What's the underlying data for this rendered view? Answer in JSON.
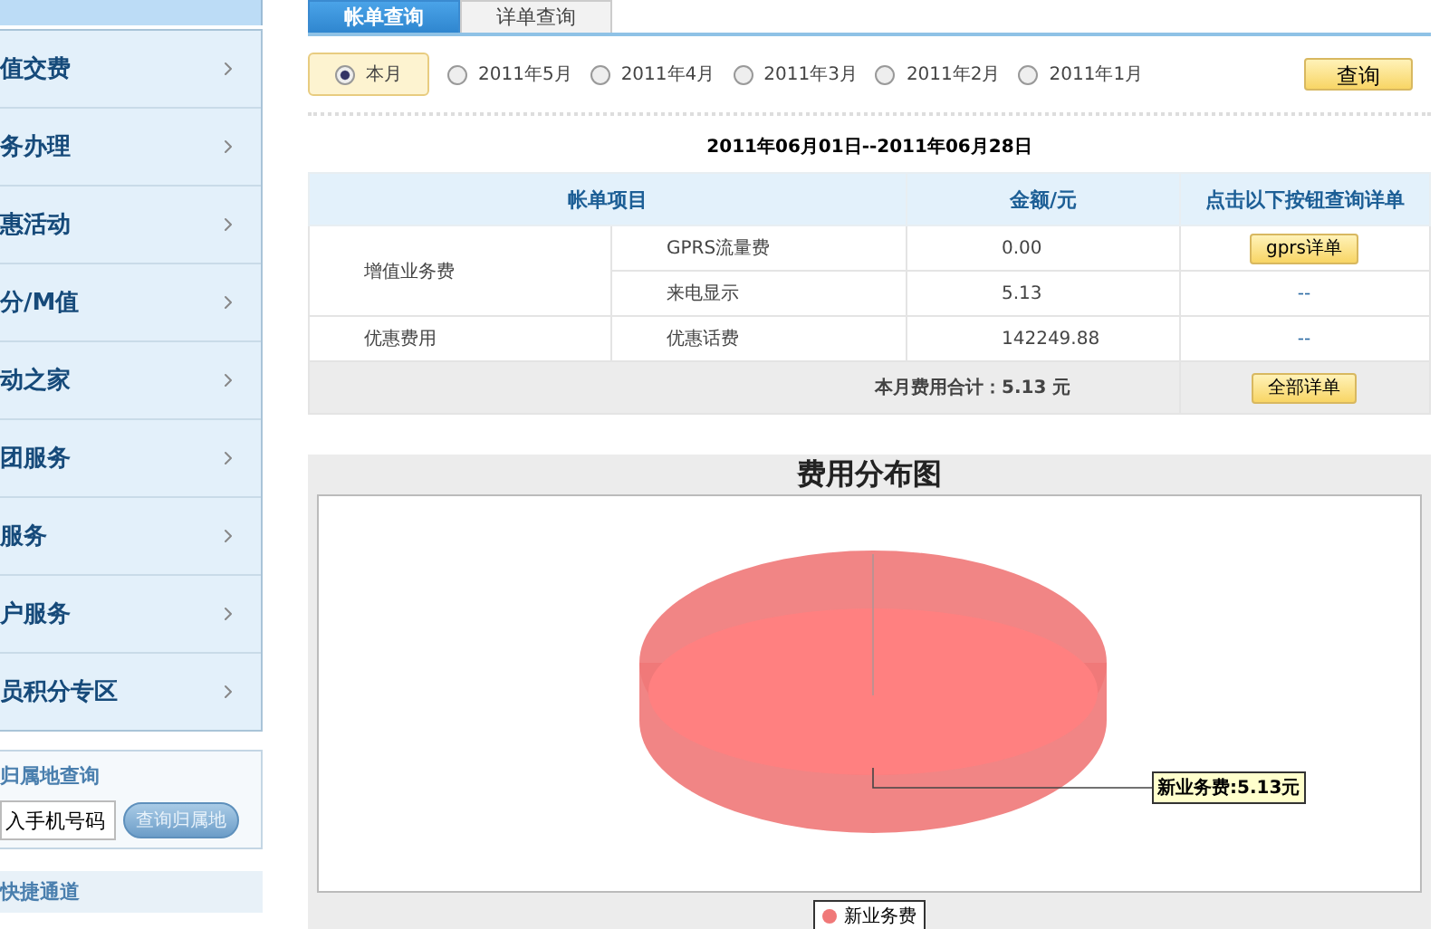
{
  "sidebar": {
    "items": [
      {
        "label": "值交费"
      },
      {
        "label": "务办理"
      },
      {
        "label": "惠活动"
      },
      {
        "label": "分/M值"
      },
      {
        "label": "动之家"
      },
      {
        "label": "团服务"
      },
      {
        "label": "服务"
      },
      {
        "label": "户服务"
      },
      {
        "label": "员积分专区"
      }
    ],
    "lookup": {
      "title": "归属地查询",
      "value": "入手机号码",
      "button": "查询归属地"
    },
    "shortcut": {
      "title": "快捷通道"
    }
  },
  "tabs": [
    {
      "label": "帐单查询",
      "selected": true
    },
    {
      "label": "详单查询",
      "selected": false
    }
  ],
  "months": [
    {
      "label": "本月",
      "selected": true
    },
    {
      "label": "2011年5月",
      "selected": false
    },
    {
      "label": "2011年4月",
      "selected": false
    },
    {
      "label": "2011年3月",
      "selected": false
    },
    {
      "label": "2011年2月",
      "selected": false
    },
    {
      "label": "2011年1月",
      "selected": false
    }
  ],
  "query_button": "查询",
  "date_range": "2011年06月01日--2011年06月28日",
  "table": {
    "columns": [
      "帐单项目",
      "金额/元",
      "点击以下按钮查询详单"
    ],
    "groups": [
      {
        "name": "增值业务费",
        "items": [
          {
            "item": "GPRS流量费",
            "amount": "0.00",
            "action": {
              "kind": "button",
              "label": "gprs详单"
            }
          },
          {
            "item": "来电显示",
            "amount": "5.13",
            "action": {
              "kind": "dash",
              "label": "--"
            }
          }
        ]
      },
      {
        "name": "优惠费用",
        "items": [
          {
            "item": "优惠话费",
            "amount": "142249.88",
            "action": {
              "kind": "dash",
              "label": "--"
            }
          }
        ]
      }
    ],
    "total": {
      "label": "本月费用合计：5.13 元",
      "button": "全部详单"
    }
  },
  "chart": {
    "title": "费用分布图",
    "label": "新业务费:5.13元",
    "legend": [
      "新业务费"
    ]
  }
}
